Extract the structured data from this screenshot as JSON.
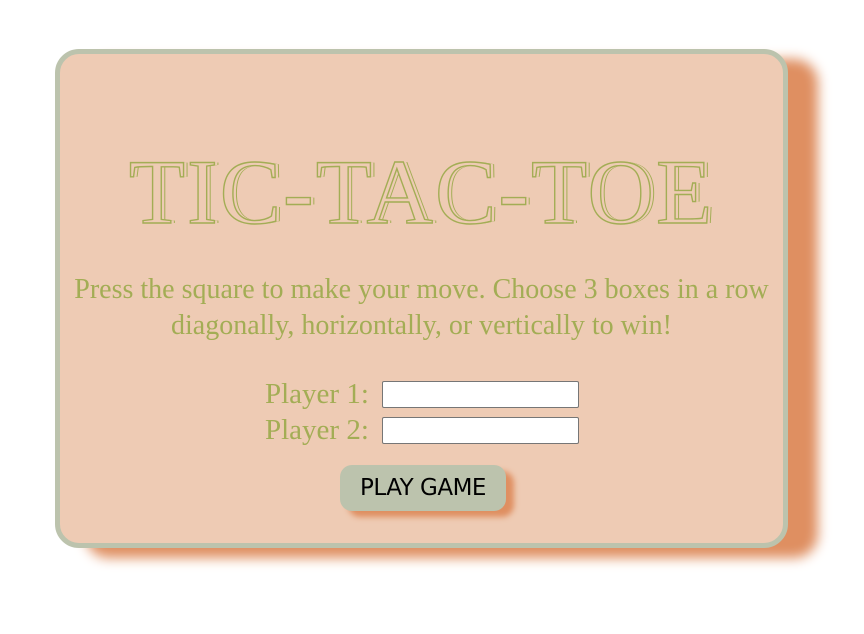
{
  "game": {
    "title": "TIC-TAC-TOE",
    "instructions": "Press the square to make your move. Choose 3 boxes in a row diagonally, horizontally, or vertically to win!",
    "player1_label": "Player 1:",
    "player1_value": "",
    "player2_label": "Player 2:",
    "player2_value": "",
    "play_button_label": "PLAY GAME"
  },
  "colors": {
    "card_background": "#eecbb4",
    "card_border": "#bcc3ad",
    "card_shadow": "#df8f61",
    "text_accent": "#a3ad55",
    "button_background": "#bcc3ad"
  }
}
